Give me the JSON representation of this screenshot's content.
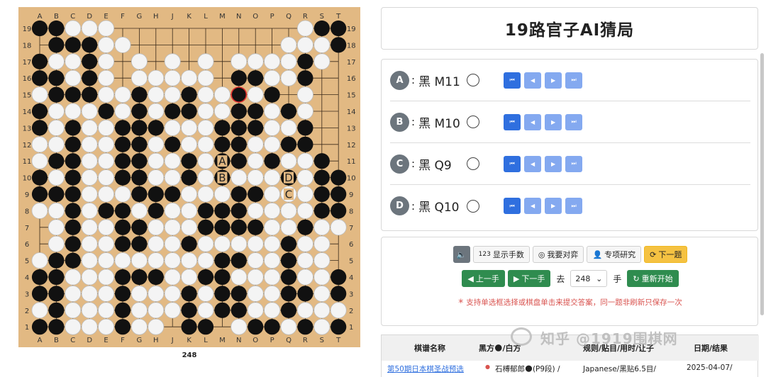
{
  "board": {
    "columns": [
      "A",
      "B",
      "C",
      "D",
      "E",
      "F",
      "G",
      "H",
      "J",
      "K",
      "L",
      "M",
      "N",
      "O",
      "P",
      "Q",
      "R",
      "S",
      "T"
    ],
    "rows_top_to_bottom": [
      "19",
      "18",
      "17",
      "16",
      "15",
      "14",
      "13",
      "12",
      "11",
      "10",
      "9",
      "8",
      "7",
      "6",
      "5",
      "4",
      "3",
      "2",
      "1"
    ],
    "position": [
      "XXOOO...........OXX",
      ".XXXOO.........OOOX",
      "XOOXO.O.O.O.OOOOXO.",
      "XXOXO.OOOOO.XXOOX..",
      "OXXXOOXOOXOOXOX.O..",
      "XOOOXOXOXXOOXXOXO..",
      "XOXOOXXXOOOXXXOOX..",
      "OOXOOXXOXOOXXOOXX..",
      "OXXOOXXOOXOXXOXOOX.",
      "XOXOOXXOOXOXOOOXOXX",
      "XXXOOOXXXOOOXXOOOXX",
      "OOXOXXOXOOXXXOOOOXX",
      ".OXOOXXOOOXXXXOOXOO",
      ".OXOOXXOOXOOOOOXOO.",
      "OXXOOOOOOOOXXOOXOO.",
      "XXOOOXXXOOXXOOOXOOX",
      "XXOOOXOOOXOXXOOXXOX",
      "OXOOOXOOOXOXXOOXOOO",
      "XXOOOXOO.XX.OXXOXOX"
    ],
    "marks": [
      {
        "label": "A",
        "col": "M",
        "row": "11"
      },
      {
        "label": "B",
        "col": "M",
        "row": "10"
      },
      {
        "label": "C",
        "col": "Q",
        "row": "9"
      },
      {
        "label": "D",
        "col": "Q",
        "row": "10"
      }
    ],
    "last_move": {
      "col": "N",
      "row": "15"
    },
    "move_number": "248"
  },
  "title": "19路官子AI猜局",
  "choices": [
    {
      "letter": "A",
      "colon": ":",
      "answer": "黑 M11"
    },
    {
      "letter": "B",
      "colon": ":",
      "answer": "黑 M10"
    },
    {
      "letter": "C",
      "colon": ":",
      "answer": "黑 Q9"
    },
    {
      "letter": "D",
      "colon": ":",
      "answer": "黑 Q10"
    }
  ],
  "nav_icons": [
    "first-icon",
    "prev-icon",
    "next-icon",
    "last-icon"
  ],
  "toolbar": {
    "sound_icon": "sound-icon",
    "show_moves": "显示手数",
    "show_moves_icon_text": "123",
    "play_me": "我要对弈",
    "study": "专项研究",
    "next_problem": "下一题"
  },
  "navigation": {
    "prev_move": "上一手",
    "next_move": "下一手",
    "go_to": "去",
    "move_select": "248",
    "move_unit": "手",
    "restart": "重新开始"
  },
  "notice": "支持单选框选择或棋盘单击来提交答案，同一题非刷新只保存一次",
  "table": {
    "headers": [
      "棋谱名称",
      "黑方🌑/白方",
      "规则/贴目/用时/让子",
      "日期/结果"
    ],
    "row": [
      "第50期日本棋圣战预选",
      "石榑郁郎🌑(P9段) /",
      "Japanese/黑贴6.5目/",
      "2025-04-07/"
    ]
  },
  "watermark": "知乎 @1919围棋网",
  "colors": {
    "black_stone": "#111111",
    "white_stone": "#f4f4f4",
    "board": "#e2b983",
    "accent_blue": "#2f6fdf",
    "green": "#2f8c4f",
    "yellow": "#f5c242",
    "last_move_ring": "#e03030"
  }
}
